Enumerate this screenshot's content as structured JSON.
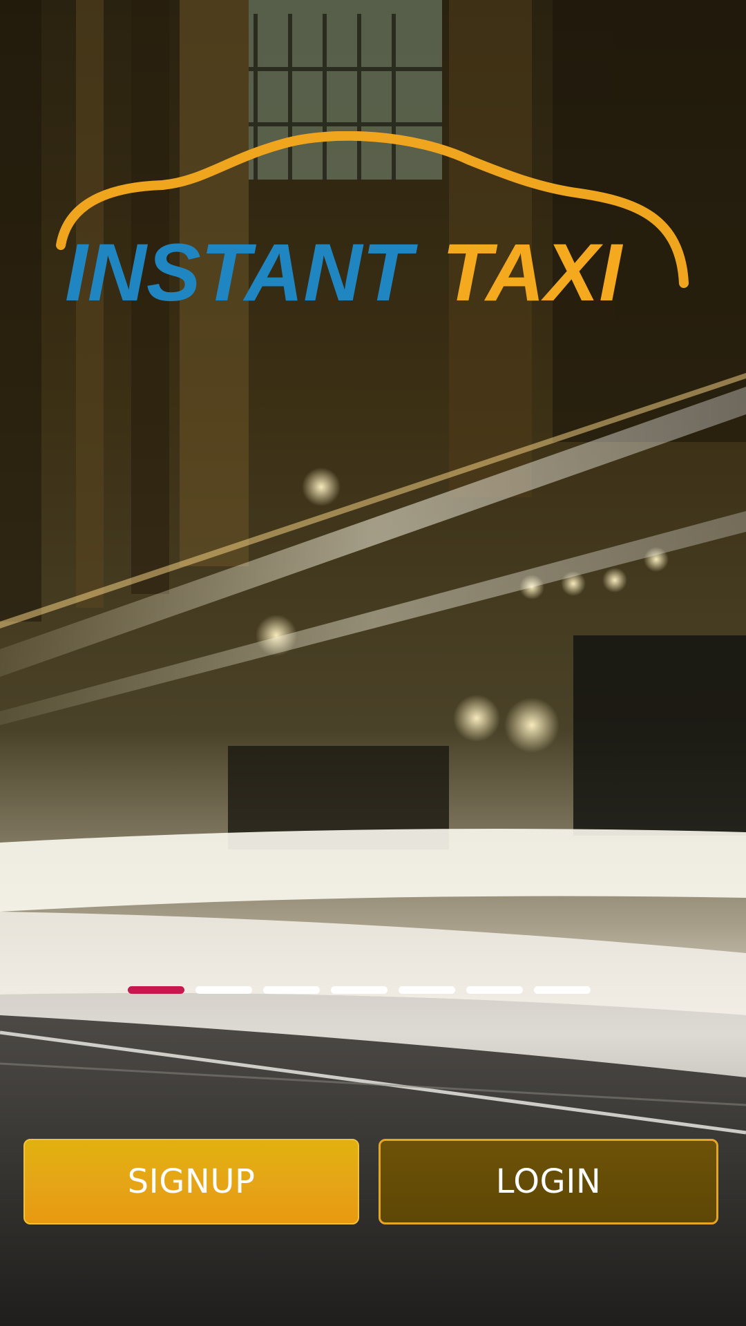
{
  "logo": {
    "text_left": "INSTANT",
    "text_right": "TAXI",
    "color_left": "#1f86c2",
    "color_right": "#f5a91e",
    "arc_color": "#f0a51f"
  },
  "background": {
    "description_icon": "night-street-light-trails-image"
  },
  "pager": {
    "total": 7,
    "active_index": 0,
    "active_color": "#c8174f",
    "inactive_color": "#ffffff"
  },
  "actions": {
    "signup_label": "SIGNUP",
    "login_label": "LOGIN"
  }
}
